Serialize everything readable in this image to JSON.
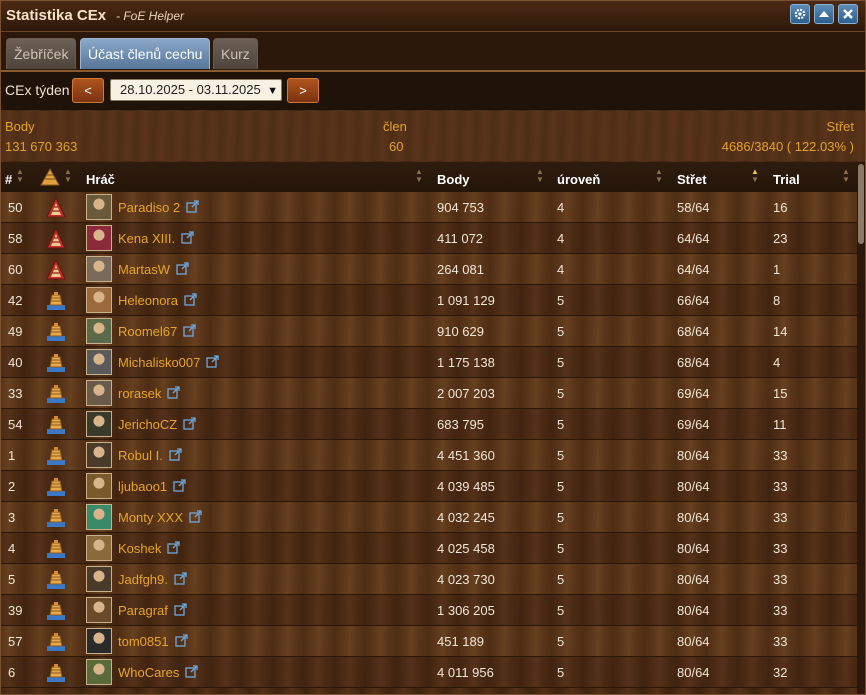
{
  "window": {
    "title": "Statistika CEx",
    "subtitle": "- FoE Helper",
    "buttons": [
      "settings-icon",
      "minimize-icon",
      "close-icon"
    ]
  },
  "tabs": [
    {
      "label": "Žebříček",
      "active": false
    },
    {
      "label": "Účast členů cechu",
      "active": true
    },
    {
      "label": "Kurz",
      "active": false
    }
  ],
  "week": {
    "label": "CEx týden",
    "prev_label": "<",
    "next_label": ">",
    "selected": "28.10.2025 - 03.11.2025"
  },
  "summary": {
    "body_label": "Body",
    "body_value": "131 670 363",
    "member_label": "člen",
    "member_value": "60",
    "strike_label": "Střet",
    "strike_value": "4686/3840 ( 122.03% )"
  },
  "columns": {
    "rank": "#",
    "player": "Hráč",
    "body": "Body",
    "level": "úroveň",
    "strike": "Střet",
    "trial": "Trial"
  },
  "rows": [
    {
      "rank": "50",
      "badge": "red",
      "name": "Paradiso 2",
      "body": "904 753",
      "level": "4",
      "strike": "58/64",
      "trial": "16",
      "avatar": "#6a5a3a"
    },
    {
      "rank": "58",
      "badge": "red",
      "name": "Kena XIII.",
      "body": "411 072",
      "level": "4",
      "strike": "64/64",
      "trial": "23",
      "avatar": "#8a2a3a"
    },
    {
      "rank": "60",
      "badge": "red",
      "name": "MartasW",
      "body": "264 081",
      "level": "4",
      "strike": "64/64",
      "trial": "1",
      "avatar": "#7a6a5a"
    },
    {
      "rank": "42",
      "badge": "blue",
      "name": "Heleonora",
      "body": "1 091 129",
      "level": "5",
      "strike": "66/64",
      "trial": "8",
      "avatar": "#9a6a3a"
    },
    {
      "rank": "49",
      "badge": "blue",
      "name": "Roomel67",
      "body": "910 629",
      "level": "5",
      "strike": "68/64",
      "trial": "14",
      "avatar": "#5a6a4a"
    },
    {
      "rank": "40",
      "badge": "blue",
      "name": "Michalisko007",
      "body": "1 175 138",
      "level": "5",
      "strike": "68/64",
      "trial": "4",
      "avatar": "#5a5a5a"
    },
    {
      "rank": "33",
      "badge": "blue",
      "name": "rorasek",
      "body": "2 007 203",
      "level": "5",
      "strike": "69/64",
      "trial": "15",
      "avatar": "#6a5a4a"
    },
    {
      "rank": "54",
      "badge": "blue",
      "name": "JerichoCZ",
      "body": "683 795",
      "level": "5",
      "strike": "69/64",
      "trial": "11",
      "avatar": "#3a3a2a"
    },
    {
      "rank": "1",
      "badge": "blue",
      "name": "Robul I.",
      "body": "4 451 360",
      "level": "5",
      "strike": "80/64",
      "trial": "33",
      "avatar": "#4a3a2a"
    },
    {
      "rank": "2",
      "badge": "blue",
      "name": "ljubaoo1",
      "body": "4 039 485",
      "level": "5",
      "strike": "80/64",
      "trial": "33",
      "avatar": "#7a5a2a"
    },
    {
      "rank": "3",
      "badge": "blue",
      "name": "Monty XXX",
      "body": "4 032 245",
      "level": "5",
      "strike": "80/64",
      "trial": "33",
      "avatar": "#3a8a6a"
    },
    {
      "rank": "4",
      "badge": "blue",
      "name": "Koshek",
      "body": "4 025 458",
      "level": "5",
      "strike": "80/64",
      "trial": "33",
      "avatar": "#8a6a3a"
    },
    {
      "rank": "5",
      "badge": "blue",
      "name": "Jadfgh9.",
      "body": "4 023 730",
      "level": "5",
      "strike": "80/64",
      "trial": "33",
      "avatar": "#4a3a2a"
    },
    {
      "rank": "39",
      "badge": "blue",
      "name": "Paragraf",
      "body": "1 306 205",
      "level": "5",
      "strike": "80/64",
      "trial": "33",
      "avatar": "#6a4a2a"
    },
    {
      "rank": "57",
      "badge": "blue",
      "name": "tom0851",
      "body": "451 189",
      "level": "5",
      "strike": "80/64",
      "trial": "33",
      "avatar": "#2a2a2a"
    },
    {
      "rank": "6",
      "badge": "blue",
      "name": "WhoCares",
      "body": "4 011 956",
      "level": "5",
      "strike": "80/64",
      "trial": "32",
      "avatar": "#5a6a3a"
    }
  ],
  "colors": {
    "accent": "#e6a42a",
    "active_tab": "#6e8fb3",
    "nav_button": "#a0471a"
  }
}
